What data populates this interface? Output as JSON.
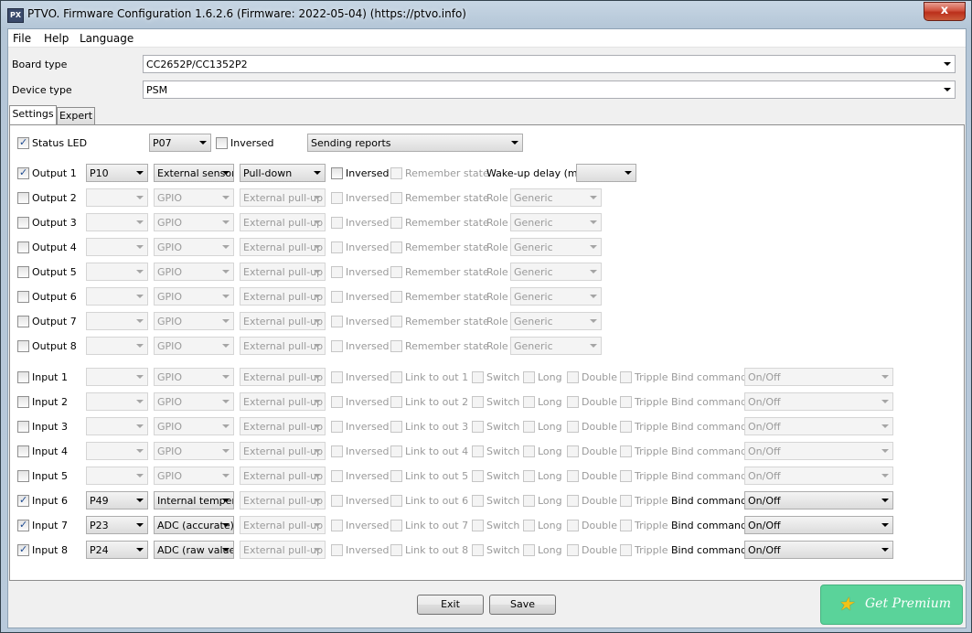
{
  "window": {
    "title": "PTVO. Firmware Configuration 1.6.2.6 (Firmware: 2022-05-04) (https://ptvo.info)",
    "icon_text": "PX",
    "close_label": "x"
  },
  "menu": [
    {
      "label": "File"
    },
    {
      "label": "Help"
    },
    {
      "label": "Language"
    }
  ],
  "board_type": {
    "label": "Board type",
    "value": "CC2652P/CC1352P2"
  },
  "device_type": {
    "label": "Device type",
    "value": "PSM"
  },
  "tabs": [
    {
      "label": "Settings",
      "active": true
    },
    {
      "label": "Expert",
      "active": false
    }
  ],
  "status_led": {
    "label": "Status LED",
    "checked": true,
    "pin": "P07",
    "inversed_label": "Inversed",
    "inversed": false,
    "mode": "Sending reports"
  },
  "outputs": [
    {
      "label": "Output 1",
      "checked": true,
      "pin": "P10",
      "type": "External sensor",
      "pull": "Pull-down",
      "inversed_label": "Inversed",
      "remember_label": "Remember state",
      "extra_label": "Wake-up delay (ms)",
      "extra_value": "",
      "enabled": true
    },
    {
      "label": "Output 2",
      "checked": false,
      "pin": "",
      "type": "GPIO",
      "pull": "External pull-up",
      "inversed_label": "Inversed",
      "remember_label": "Remember state",
      "extra_label": "Role",
      "extra_value": "Generic",
      "enabled": false
    },
    {
      "label": "Output 3",
      "checked": false,
      "pin": "",
      "type": "GPIO",
      "pull": "External pull-up",
      "inversed_label": "Inversed",
      "remember_label": "Remember state",
      "extra_label": "Role",
      "extra_value": "Generic",
      "enabled": false
    },
    {
      "label": "Output 4",
      "checked": false,
      "pin": "",
      "type": "GPIO",
      "pull": "External pull-up",
      "inversed_label": "Inversed",
      "remember_label": "Remember state",
      "extra_label": "Role",
      "extra_value": "Generic",
      "enabled": false
    },
    {
      "label": "Output 5",
      "checked": false,
      "pin": "",
      "type": "GPIO",
      "pull": "External pull-up",
      "inversed_label": "Inversed",
      "remember_label": "Remember state",
      "extra_label": "Role",
      "extra_value": "Generic",
      "enabled": false
    },
    {
      "label": "Output 6",
      "checked": false,
      "pin": "",
      "type": "GPIO",
      "pull": "External pull-up",
      "inversed_label": "Inversed",
      "remember_label": "Remember state",
      "extra_label": "Role",
      "extra_value": "Generic",
      "enabled": false
    },
    {
      "label": "Output 7",
      "checked": false,
      "pin": "",
      "type": "GPIO",
      "pull": "External pull-up",
      "inversed_label": "Inversed",
      "remember_label": "Remember state",
      "extra_label": "Role",
      "extra_value": "Generic",
      "enabled": false
    },
    {
      "label": "Output 8",
      "checked": false,
      "pin": "",
      "type": "GPIO",
      "pull": "External pull-up",
      "inversed_label": "Inversed",
      "remember_label": "Remember state",
      "extra_label": "Role",
      "extra_value": "Generic",
      "enabled": false
    }
  ],
  "inputs": [
    {
      "label": "Input 1",
      "checked": false,
      "pin": "",
      "type": "GPIO",
      "pull": "External pull-up",
      "inversed_label": "Inversed",
      "link_label": "Link to out 1",
      "switch_label": "Switch",
      "long_label": "Long",
      "double_label": "Double",
      "tripple_label": "Tripple",
      "bind_label": "Bind command",
      "bind_value": "On/Off",
      "enabled": false
    },
    {
      "label": "Input 2",
      "checked": false,
      "pin": "",
      "type": "GPIO",
      "pull": "External pull-up",
      "inversed_label": "Inversed",
      "link_label": "Link to out 2",
      "switch_label": "Switch",
      "long_label": "Long",
      "double_label": "Double",
      "tripple_label": "Tripple",
      "bind_label": "Bind command",
      "bind_value": "On/Off",
      "enabled": false
    },
    {
      "label": "Input 3",
      "checked": false,
      "pin": "",
      "type": "GPIO",
      "pull": "External pull-up",
      "inversed_label": "Inversed",
      "link_label": "Link to out 3",
      "switch_label": "Switch",
      "long_label": "Long",
      "double_label": "Double",
      "tripple_label": "Tripple",
      "bind_label": "Bind command",
      "bind_value": "On/Off",
      "enabled": false
    },
    {
      "label": "Input 4",
      "checked": false,
      "pin": "",
      "type": "GPIO",
      "pull": "External pull-up",
      "inversed_label": "Inversed",
      "link_label": "Link to out 4",
      "switch_label": "Switch",
      "long_label": "Long",
      "double_label": "Double",
      "tripple_label": "Tripple",
      "bind_label": "Bind command",
      "bind_value": "On/Off",
      "enabled": false
    },
    {
      "label": "Input 5",
      "checked": false,
      "pin": "",
      "type": "GPIO",
      "pull": "External pull-up",
      "inversed_label": "Inversed",
      "link_label": "Link to out 5",
      "switch_label": "Switch",
      "long_label": "Long",
      "double_label": "Double",
      "tripple_label": "Tripple",
      "bind_label": "Bind command",
      "bind_value": "On/Off",
      "enabled": false
    },
    {
      "label": "Input 6",
      "checked": true,
      "pin": "P49",
      "type": "Internal temperature",
      "pull": "External pull-up",
      "inversed_label": "Inversed",
      "link_label": "Link to out 6",
      "switch_label": "Switch",
      "long_label": "Long",
      "double_label": "Double",
      "tripple_label": "Tripple",
      "bind_label": "Bind command",
      "bind_value": "On/Off",
      "enabled": true
    },
    {
      "label": "Input 7",
      "checked": true,
      "pin": "P23",
      "type": "ADC (accurate)",
      "pull": "External pull-up",
      "inversed_label": "Inversed",
      "link_label": "Link to out 7",
      "switch_label": "Switch",
      "long_label": "Long",
      "double_label": "Double",
      "tripple_label": "Tripple",
      "bind_label": "Bind command",
      "bind_value": "On/Off",
      "enabled": true
    },
    {
      "label": "Input 8",
      "checked": true,
      "pin": "P24",
      "type": "ADC (raw value)",
      "pull": "External pull-up",
      "inversed_label": "Inversed",
      "link_label": "Link to out 8",
      "switch_label": "Switch",
      "long_label": "Long",
      "double_label": "Double",
      "tripple_label": "Tripple",
      "bind_label": "Bind command",
      "bind_value": "On/Off",
      "enabled": true
    }
  ],
  "buttons": {
    "exit": "Exit",
    "save": "Save",
    "premium": "Get Premium"
  },
  "colors": {
    "premium_bg": "#5ad39a",
    "check": "#1e4b91",
    "disabled_text": "#9a9a9a"
  }
}
